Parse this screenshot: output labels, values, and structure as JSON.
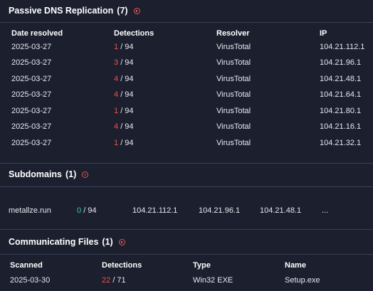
{
  "passive_dns": {
    "title": "Passive DNS Replication",
    "count": "(7)",
    "columns": [
      "Date resolved",
      "Detections",
      "Resolver",
      "IP"
    ],
    "rows": [
      {
        "date": "2025-03-27",
        "det_hit": "1",
        "det_total": "/ 94",
        "resolver": "VirusTotal",
        "ip": "104.21.112.1"
      },
      {
        "date": "2025-03-27",
        "det_hit": "3",
        "det_total": "/ 94",
        "resolver": "VirusTotal",
        "ip": "104.21.96.1"
      },
      {
        "date": "2025-03-27",
        "det_hit": "4",
        "det_total": "/ 94",
        "resolver": "VirusTotal",
        "ip": "104.21.48.1"
      },
      {
        "date": "2025-03-27",
        "det_hit": "4",
        "det_total": "/ 94",
        "resolver": "VirusTotal",
        "ip": "104.21.64.1"
      },
      {
        "date": "2025-03-27",
        "det_hit": "1",
        "det_total": "/ 94",
        "resolver": "VirusTotal",
        "ip": "104.21.80.1"
      },
      {
        "date": "2025-03-27",
        "det_hit": "4",
        "det_total": "/ 94",
        "resolver": "VirusTotal",
        "ip": "104.21.16.1"
      },
      {
        "date": "2025-03-27",
        "det_hit": "1",
        "det_total": "/ 94",
        "resolver": "VirusTotal",
        "ip": "104.21.32.1"
      }
    ]
  },
  "subdomains": {
    "title": "Subdomains",
    "count": "(1)",
    "row": {
      "domain": "metallze.run",
      "det_hit": "0",
      "det_total": "/ 94",
      "ips": [
        "104.21.112.1",
        "104.21.96.1",
        "104.21.48.1"
      ],
      "more": "..."
    }
  },
  "communicating_files": {
    "title": "Communicating Files",
    "count": "(1)",
    "columns": [
      "Scanned",
      "Detections",
      "Type",
      "Name"
    ],
    "row": {
      "scanned": "2025-03-30",
      "det_hit": "22",
      "det_total": "/ 71",
      "type": "Win32 EXE",
      "name": "Setup.exe"
    }
  },
  "colors": {
    "background": "#1c1f2e",
    "detection_red": "#f0524a",
    "detection_clean": "#35c9a0",
    "info_icon": "#e05a5a",
    "divider": "#3a3f55"
  }
}
